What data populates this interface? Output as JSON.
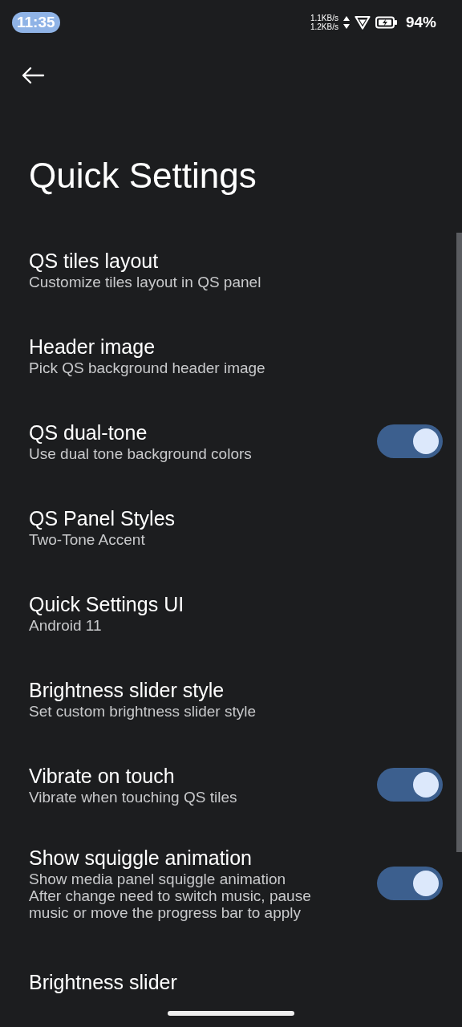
{
  "status_bar": {
    "time": "11:35",
    "upload_speed": "1.1KB/s",
    "download_speed": "1.2KB/s",
    "battery": "94%"
  },
  "title": "Quick Settings",
  "settings": [
    {
      "kind": "link",
      "title": "QS tiles layout",
      "summary": "Customize tiles layout in QS panel"
    },
    {
      "kind": "link",
      "title": "Header image",
      "summary": "Pick QS background header image"
    },
    {
      "kind": "switch",
      "title": "QS dual-tone",
      "summary": "Use dual tone background colors",
      "on": true
    },
    {
      "kind": "link",
      "title": "QS Panel Styles",
      "summary": "Two-Tone Accent"
    },
    {
      "kind": "link",
      "title": "Quick Settings UI",
      "summary": "Android 11"
    },
    {
      "kind": "link",
      "title": "Brightness slider style",
      "summary": "Set custom brightness slider style"
    },
    {
      "kind": "switch",
      "title": "Vibrate on touch",
      "summary": "Vibrate when touching QS tiles",
      "on": true
    },
    {
      "kind": "switch",
      "title": "Show squiggle animation",
      "summary": "Show media panel squiggle animation\nAfter change need to switch music, pause music or move the progress bar to apply",
      "on": true
    },
    {
      "kind": "header",
      "title": "Brightness slider"
    }
  ]
}
